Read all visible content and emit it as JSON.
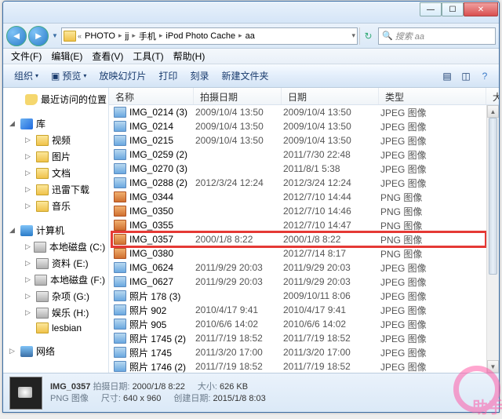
{
  "window": {
    "min": "—",
    "max": "☐",
    "close": "✕"
  },
  "breadcrumb": {
    "segs": [
      "PHOTO",
      "jj",
      "手机",
      "iPod Photo Cache",
      "aa"
    ],
    "refresh": "↻"
  },
  "search_placeholder": "搜索 aa",
  "menubar": {
    "file": "文件(F)",
    "edit": "编辑(E)",
    "view": "查看(V)",
    "tools": "工具(T)",
    "help": "帮助(H)"
  },
  "toolbar": {
    "organize": "组织",
    "preview": "预览",
    "slideshow": "放映幻灯片",
    "print": "打印",
    "burn": "刻录",
    "newfolder": "新建文件夹"
  },
  "sidebar": {
    "recent": "最近访问的位置",
    "libraries": "库",
    "videos": "视频",
    "pictures": "图片",
    "documents": "文档",
    "xunlei": "迅雷下载",
    "music": "音乐",
    "computer": "计算机",
    "drive_c": "本地磁盘 (C:)",
    "drive_e": "资料 (E:)",
    "drive_f": "本地磁盘 (F:)",
    "drive_g": "杂项 (G:)",
    "drive_h": "娱乐 (H:)",
    "lesbian": "lesbian",
    "network": "网络"
  },
  "columns": {
    "name": "名称",
    "shot": "拍摄日期",
    "date": "日期",
    "type": "类型"
  },
  "files": [
    {
      "name": "IMG_0214 (3)",
      "shot": "2009/10/4 13:50",
      "date": "2009/10/4 13:50",
      "type": "JPEG 图像",
      "kind": "jpg"
    },
    {
      "name": "IMG_0214",
      "shot": "2009/10/4 13:50",
      "date": "2009/10/4 13:50",
      "type": "JPEG 图像",
      "kind": "jpg"
    },
    {
      "name": "IMG_0215",
      "shot": "2009/10/4 13:50",
      "date": "2009/10/4 13:50",
      "type": "JPEG 图像",
      "kind": "jpg"
    },
    {
      "name": "IMG_0259 (2)",
      "shot": "",
      "date": "2011/7/30 22:48",
      "type": "JPEG 图像",
      "kind": "jpg"
    },
    {
      "name": "IMG_0270 (3)",
      "shot": "",
      "date": "2011/8/1 5:38",
      "type": "JPEG 图像",
      "kind": "jpg"
    },
    {
      "name": "IMG_0288 (2)",
      "shot": "2012/3/24 12:24",
      "date": "2012/3/24 12:24",
      "type": "JPEG 图像",
      "kind": "jpg"
    },
    {
      "name": "IMG_0344",
      "shot": "",
      "date": "2012/7/10 14:44",
      "type": "PNG 图像",
      "kind": "png"
    },
    {
      "name": "IMG_0350",
      "shot": "",
      "date": "2012/7/10 14:46",
      "type": "PNG 图像",
      "kind": "png"
    },
    {
      "name": "IMG_0355",
      "shot": "",
      "date": "2012/7/10 14:47",
      "type": "PNG 图像",
      "kind": "png"
    },
    {
      "name": "IMG_0357",
      "shot": "2000/1/8 8:22",
      "date": "2000/1/8 8:22",
      "type": "PNG 图像",
      "kind": "png"
    },
    {
      "name": "IMG_0380",
      "shot": "",
      "date": "2012/7/14 8:17",
      "type": "PNG 图像",
      "kind": "png"
    },
    {
      "name": "IMG_0624",
      "shot": "2011/9/29 20:03",
      "date": "2011/9/29 20:03",
      "type": "JPEG 图像",
      "kind": "jpg"
    },
    {
      "name": "IMG_0627",
      "shot": "2011/9/29 20:03",
      "date": "2011/9/29 20:03",
      "type": "JPEG 图像",
      "kind": "jpg"
    },
    {
      "name": "照片 178 (3)",
      "shot": "",
      "date": "2009/10/11 8:06",
      "type": "JPEG 图像",
      "kind": "jpg"
    },
    {
      "name": "照片 902",
      "shot": "2010/4/17 9:41",
      "date": "2010/4/17 9:41",
      "type": "JPEG 图像",
      "kind": "jpg"
    },
    {
      "name": "照片 905",
      "shot": "2010/6/6 14:02",
      "date": "2010/6/6 14:02",
      "type": "JPEG 图像",
      "kind": "jpg"
    },
    {
      "name": "照片 1745 (2)",
      "shot": "2011/7/19 18:52",
      "date": "2011/7/19 18:52",
      "type": "JPEG 图像",
      "kind": "jpg"
    },
    {
      "name": "照片 1745",
      "shot": "2011/3/20 17:00",
      "date": "2011/3/20 17:00",
      "type": "JPEG 图像",
      "kind": "jpg"
    },
    {
      "name": "照片 1746 (2)",
      "shot": "2011/7/19 18:52",
      "date": "2011/7/19 18:52",
      "type": "JPEG 图像",
      "kind": "jpg"
    }
  ],
  "status": {
    "filename": "IMG_0357",
    "shot_k": "拍摄日期:",
    "shot_v": "2000/1/8 8:22",
    "type_k": "",
    "type_v": "PNG 图像",
    "dim_k": "尺寸:",
    "dim_v": "640 x 960",
    "size_k": "大小:",
    "size_v": "626 KB",
    "created_k": "创建日期:",
    "created_v": "2015/1/8 8:03"
  },
  "watermark": "助手"
}
